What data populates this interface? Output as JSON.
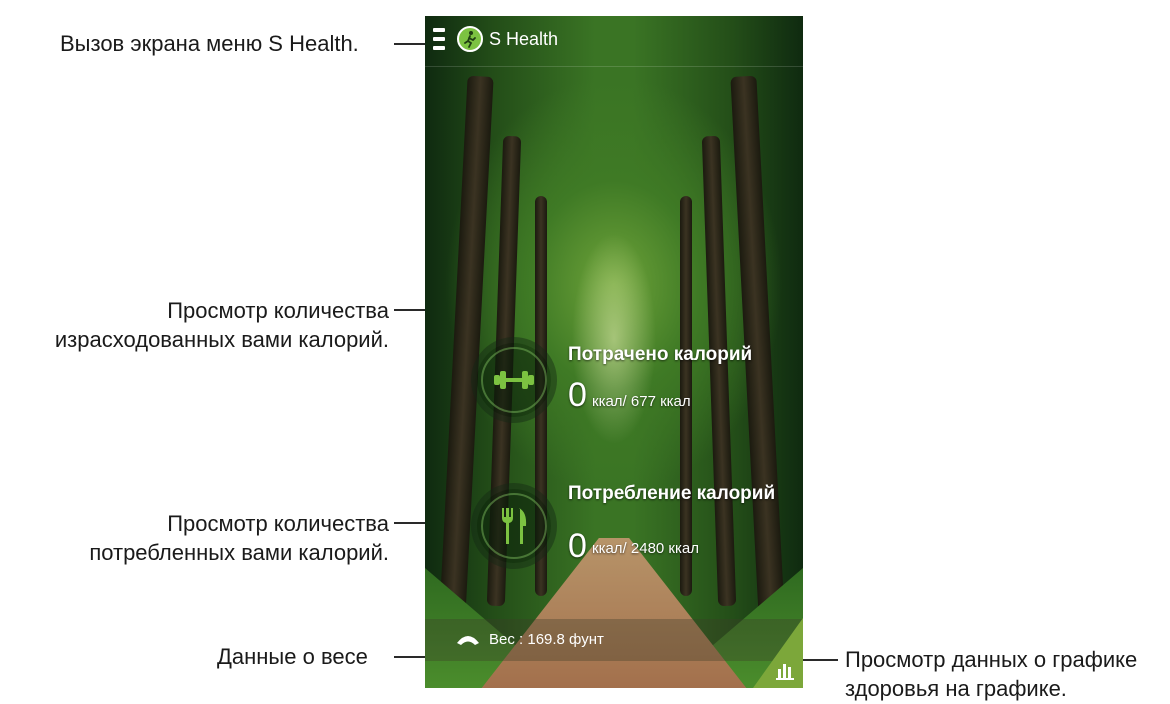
{
  "callouts": {
    "menu": "Вызов экрана меню S Health.",
    "spent_line1": "Просмотр количества",
    "spent_line2": "израсходованных вами калорий.",
    "consumed_line1": "Просмотр количества",
    "consumed_line2": "потребленных вами калорий.",
    "weight": "Данные о весе",
    "graph_line1": "Просмотр данных о графике",
    "graph_line2": "здоровья на графике."
  },
  "app": {
    "title": "S Health",
    "icons": {
      "menu": "menu-icon",
      "logo": "s-health-logo-icon",
      "burned": "dumbbell-icon",
      "consumed": "fork-knife-icon",
      "weight": "scale-icon",
      "graph": "bar-chart-icon"
    },
    "colors": {
      "accent": "#7cc241",
      "text": "#ffffff"
    }
  },
  "stats": {
    "burned": {
      "title": "Потрачено калорий",
      "value": "0",
      "unit": "ккал/ 677 ккал"
    },
    "consumed": {
      "title": "Потребление калорий",
      "value": "0",
      "unit": "ккал/ 2480 ккал"
    }
  },
  "weight": {
    "text": "Вес : 169.8 фунт"
  }
}
